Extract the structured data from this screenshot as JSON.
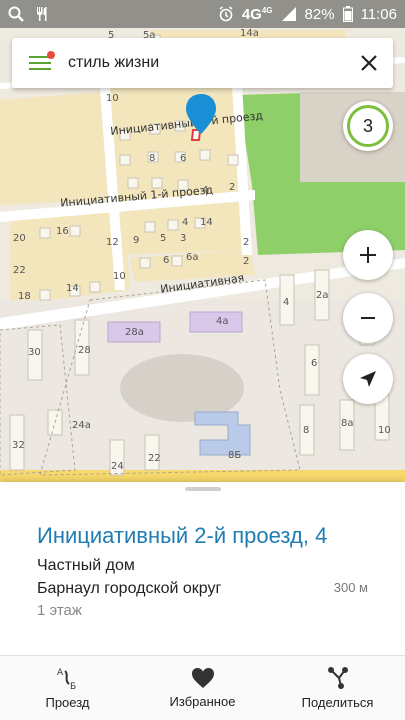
{
  "status_bar": {
    "network": "4G",
    "network_sup": "4G",
    "battery": "82%",
    "time": "11:06"
  },
  "search": {
    "query": "стиль жизни"
  },
  "map": {
    "cluster_count": "3",
    "streets": {
      "initsiativny_2": "Инициативный 2-й проезд",
      "initsiativny_1": "Инициативный 1-й проезд",
      "initsiativnaya": "Инициативная"
    },
    "house_numbers": [
      "10",
      "8",
      "6",
      "4",
      "2",
      "20",
      "16",
      "14",
      "4",
      "2",
      "12",
      "9",
      "5",
      "3",
      "22",
      "10",
      "6",
      "6а",
      "2",
      "18",
      "14",
      "28а",
      "4а",
      "30",
      "28",
      "4",
      "2а",
      "2",
      "6",
      "24а",
      "8Б",
      "8",
      "8а",
      "10",
      "32",
      "24",
      "22",
      "5",
      "5а",
      "14а"
    ]
  },
  "place": {
    "title": "Инициативный 2-й проезд, 4",
    "type": "Частный дом",
    "city": "Барнаул городской округ",
    "distance": "300 м",
    "floors": "1 этаж"
  },
  "actions": {
    "route": "Проезд",
    "favorite": "Избранное",
    "share": "Поделиться"
  },
  "colors": {
    "accent": "#1f7db3",
    "green": "#7cbf3c",
    "menu": "#5aa332"
  }
}
